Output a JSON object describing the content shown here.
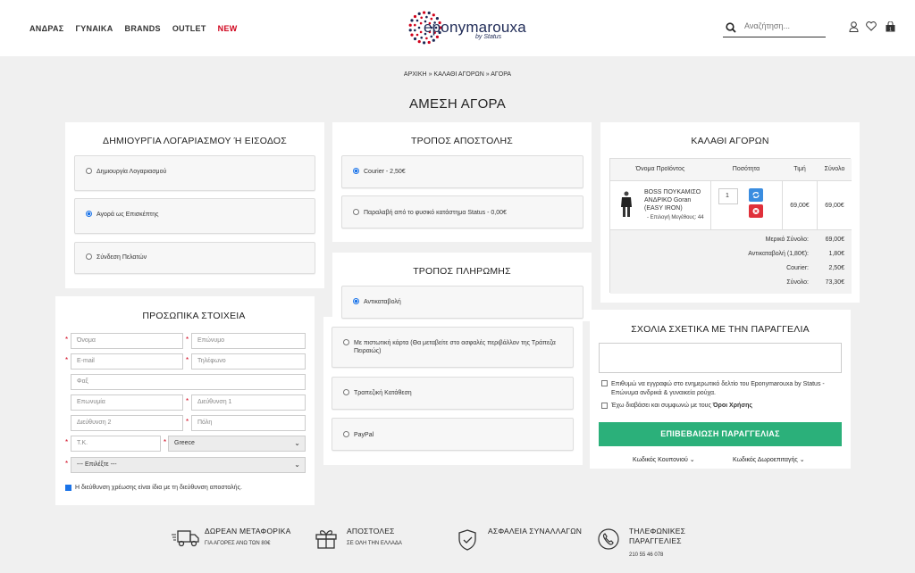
{
  "nav": {
    "items": [
      "ΑΝΔΡΑΣ",
      "ΓΥΝΑΙΚΑ",
      "BRANDS",
      "OUTLET"
    ],
    "new": "NEW"
  },
  "logo": {
    "text": "eponymarouxa",
    "sub": "by Status"
  },
  "search": {
    "placeholder": "Αναζήτηση..."
  },
  "breadcrumb": [
    "ΑΡΧΙΚΗ",
    "»",
    "ΚΑΛΑΘΙ ΑΓΟΡΩΝ",
    "»",
    "ΑΓΟΡΑ"
  ],
  "page_title": "ΑΜΕΣΗ ΑΓΟΡΑ",
  "account": {
    "title": "ΔΗΜΙΟΥΡΓΙΑ ΛΟΓΑΡΙΑΣΜΟΥ Ή ΕΙΣΟΔΟΣ",
    "options": [
      "Δημιουργία Λογαριασμού",
      "Αγορά ως Επισκέπτης",
      "Σύνδεση Πελατών"
    ],
    "selected": 1
  },
  "personal": {
    "title": "ΠΡΟΣΩΠΙΚΑ ΣΤΟΙΧΕΙΑ",
    "first_name": "Όνομα",
    "last_name": "Επώνυμο",
    "email": "E-mail",
    "phone": "Τηλέφωνο",
    "fax": "Φαξ",
    "company": "Επωνυμία",
    "address1": "Διεύθυνση 1",
    "address2": "Διεύθυνση 2",
    "city": "Πόλη",
    "zip": "Τ.Κ.",
    "country": "Greece",
    "region": "--- Επιλέξτε ---",
    "same_address": "Η διεύθυνση χρέωσης είναι ίδια με τη διεύθυνση αποστολής."
  },
  "shipping": {
    "title": "ΤΡΟΠΟΣ ΑΠΟΣΤΟΛΗΣ",
    "options": [
      "Courier - 2,50€",
      "Παραλαβή από το φυσικό κατάστημα Status - 0,00€"
    ],
    "selected": 0
  },
  "payment": {
    "title": "ΤΡΟΠΟΣ ΠΛΗΡΩΜΗΣ",
    "options": [
      "Αντικαταβολή",
      "Με πιστωτική κάρτα (Θα μεταβείτε στο ασφαλές περιβάλλον της Τράπεζα Πειραιώς)",
      "Τραπεζική Κατάθεση",
      "PayPal"
    ],
    "selected": 0
  },
  "cart": {
    "title": "ΚΑΛΑΘΙ ΑΓΟΡΩΝ",
    "headers": [
      "Όνομα Προϊόντος",
      "Ποσότητα",
      "Τιμή",
      "Σύνολο"
    ],
    "item": {
      "name": "BOSS ΠΟΥΚΑΜΙΣΟ ΑΝΔΡΙΚΟ Goran (EASY IRON)",
      "option": "- Επιλογή Μεγέθους: 44",
      "qty": "1",
      "price": "69,00€",
      "total": "69,00€"
    },
    "summary": [
      {
        "label": "Μερικό Σύνολο:",
        "value": "69,00€"
      },
      {
        "label": "Αντικαταβολή (1,80€):",
        "value": "1,80€"
      },
      {
        "label": "Courier:",
        "value": "2,50€"
      },
      {
        "label": "Σύνολο:",
        "value": "73,30€"
      }
    ]
  },
  "comments": {
    "title": "ΣΧΟΛΙΑ ΣΧΕΤΙΚΑ ΜΕ ΤΗΝ ΠΑΡΑΓΓΕΛΙΑ",
    "newsletter": "Επιθυμώ να εγγραφώ στο ενημερωτικό δελτίο του Eponymarouxa by Status - Επώνυμα ανδρικά & γυναικεία ρούχα.",
    "terms_prefix": "Έχω διαβάσει και συμφωνώ με τους",
    "terms_link": "Όροι Χρήσης",
    "confirm": "ΕΠΙΒΕΒΑΙΩΣΗ ΠΑΡΑΓΓΕΛΙΑΣ",
    "coupon": "Κωδικός Κουπονιού",
    "voucher": "Κωδικός Δωροεπιταγής"
  },
  "footer": [
    {
      "title": "ΔΩΡΕΑΝ ΜΕΤΑΦΟΡΙΚΑ",
      "sub": "ΓΙΑ ΑΓΟΡΕΣ ΑΝΩ ΤΩΝ 80€"
    },
    {
      "title": "ΑΠΟΣΤΟΛΕΣ",
      "sub": "ΣΕ ΟΛΗ ΤΗΝ ΕΛΛΑΔΑ"
    },
    {
      "title": "ΑΣΦΑΛΕΙΑ ΣΥΝΑΛΛΑΓΩΝ",
      "sub": ""
    },
    {
      "title": "ΤΗΛΕΦΩΝΙΚΕΣ ΠΑΡΑΓΓΕΛΙΕΣ",
      "sub": "210 55 46 078"
    }
  ],
  "colors": {
    "accent": "#2bb07a",
    "new": "#d0021b",
    "brand": "#1e2a56",
    "radio": "#1a73e8"
  }
}
